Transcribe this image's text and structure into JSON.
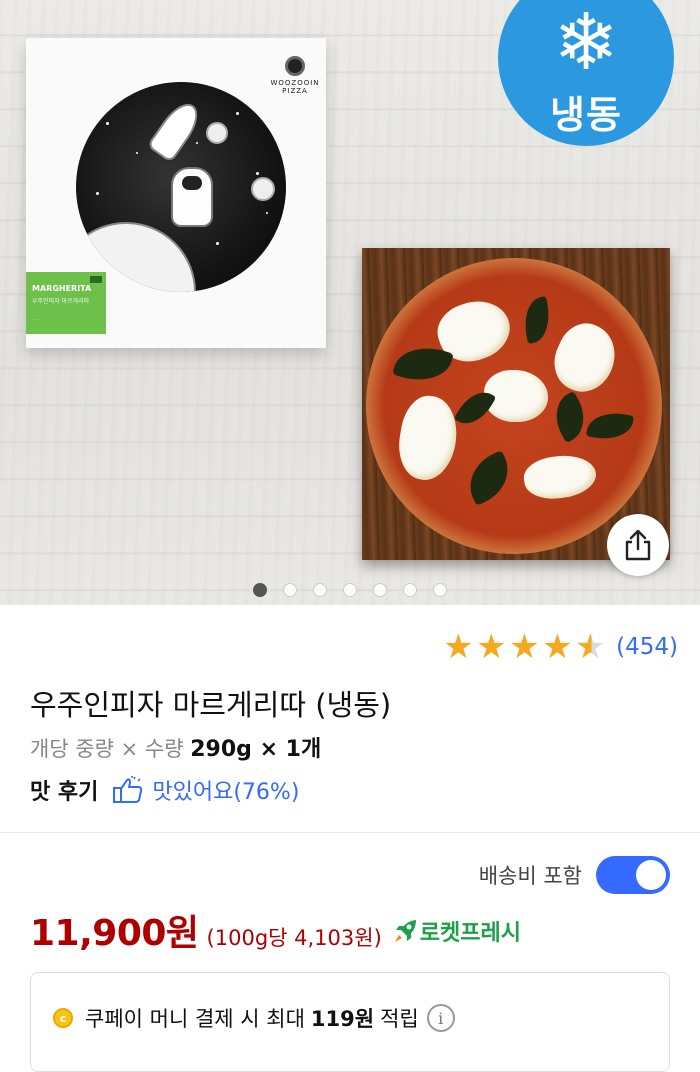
{
  "hero": {
    "frozen_badge": "냉동",
    "box_brand": "WOOZOOIN PIZZA",
    "box_label_title": "MARGHERITA",
    "box_label_sub": "우주인피자 마르게리따",
    "carousel_count": 7,
    "carousel_active_index": 0
  },
  "rating": {
    "stars_value": 4.5,
    "review_count": "(454)"
  },
  "product": {
    "title": "우주인피자 마르게리따 (냉동)",
    "spec_label": "개당 중량 × 수량",
    "spec_value": "290g × 1개",
    "taste_label": "맛 후기",
    "taste_value": "맛있어요(76%)"
  },
  "shipping": {
    "label": "배송비 포함",
    "toggle_on": true
  },
  "price": {
    "amount": "11,900원",
    "unit_price": "(100g당 4,103원)",
    "delivery_badge": "로켓프레시"
  },
  "cashback": {
    "prefix": "쿠페이 머니 결제 시 최대",
    "amount": "119원",
    "suffix": "적립"
  },
  "colors": {
    "accent_blue": "#346aff",
    "price_red": "#ae0000",
    "rocket_green": "#1ea048",
    "frozen_blue": "#2b98e0",
    "star_gold": "#f6a81f"
  }
}
